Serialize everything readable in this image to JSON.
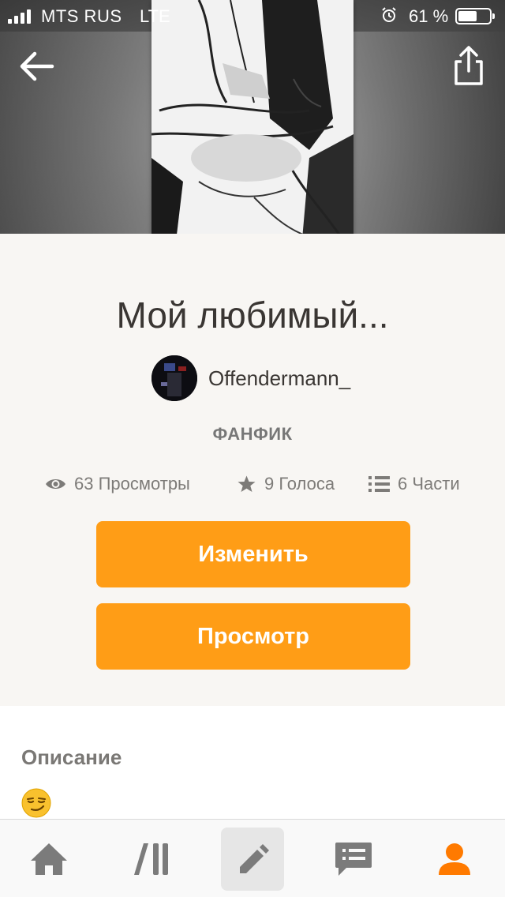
{
  "status_bar": {
    "carrier": "MTS RUS",
    "network": "LTE",
    "battery_percent": "61 %",
    "battery_level": 0.61
  },
  "story": {
    "title": "Мой любимый...",
    "author": "Offendermann_",
    "category": "ФАНФИК"
  },
  "stats": {
    "views": "63 Просмотры",
    "votes": "9 Голоса",
    "parts": "6 Части"
  },
  "buttons": {
    "edit_label": "Изменить",
    "view_label": "Просмотр"
  },
  "description": {
    "heading": "Описание",
    "emoji": "smirking-face"
  },
  "tabbar": {
    "items": [
      "home-icon",
      "library-icon",
      "write-icon",
      "messages-icon",
      "profile-icon"
    ],
    "active": "write-icon"
  },
  "colors": {
    "accent": "#ff9d16",
    "profile": "#ff7a00",
    "background": "#f8f6f3"
  }
}
